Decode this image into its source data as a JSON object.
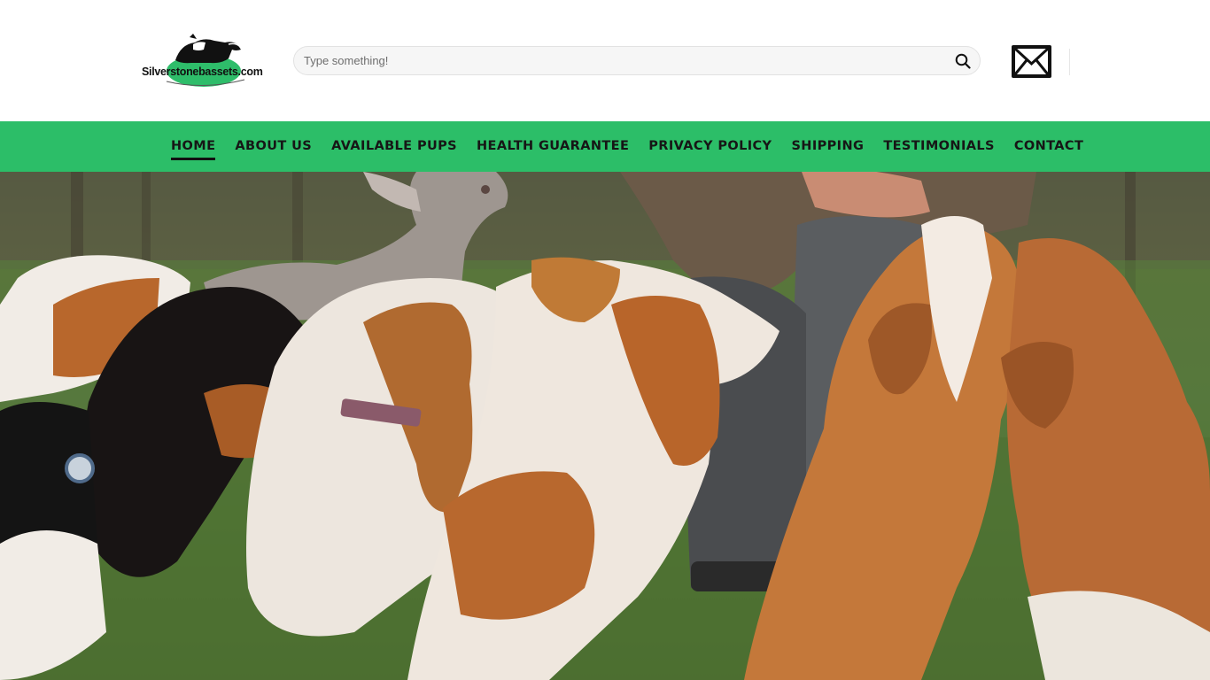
{
  "site": {
    "logo_text": "Silverstonebassets.com"
  },
  "search": {
    "placeholder": "Type something!",
    "icon": "search-icon"
  },
  "mail": {
    "icon": "envelope-icon"
  },
  "nav": {
    "items": [
      {
        "label": "HOME",
        "active": true
      },
      {
        "label": "ABOUT US",
        "active": false
      },
      {
        "label": "AVAILABLE PUPS",
        "active": false
      },
      {
        "label": "HEALTH GUARANTEE",
        "active": false
      },
      {
        "label": "PRIVACY POLICY",
        "active": false
      },
      {
        "label": "SHIPPING",
        "active": false
      },
      {
        "label": "TESTIMONIALS",
        "active": false
      },
      {
        "label": "CONTACT",
        "active": false
      }
    ]
  },
  "hero": {
    "image": "group of basset hound dogs with a person kneeling on grass"
  },
  "colors": {
    "nav_green": "#2cbe68",
    "logo_green": "#2ebd6a",
    "text_dark": "#161616"
  }
}
